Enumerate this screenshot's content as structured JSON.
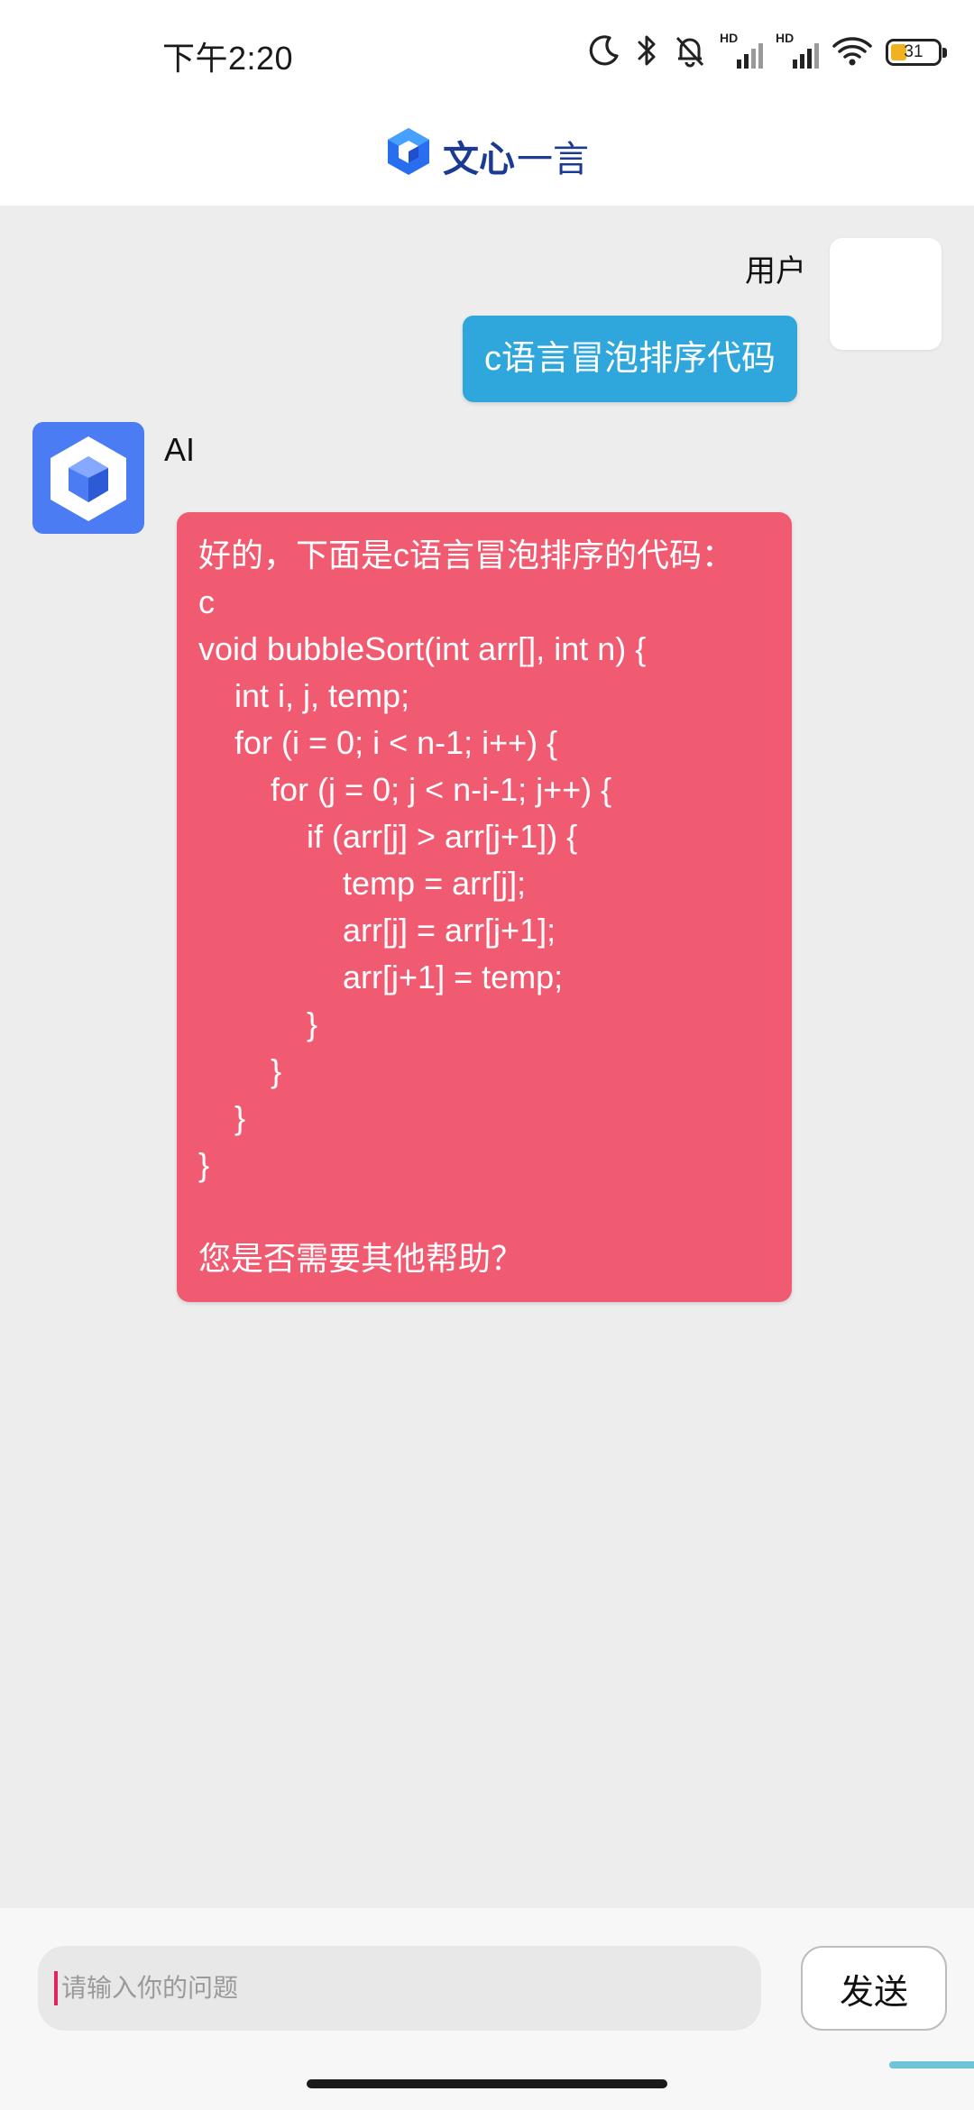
{
  "status_bar": {
    "time": "下午2:20",
    "signal1_label": "HD",
    "signal2_label": "HD",
    "battery": "31",
    "icons": [
      "moon-icon",
      "bluetooth-icon",
      "bell-off-icon",
      "signal-icon",
      "signal-icon",
      "wifi-icon",
      "battery-icon"
    ]
  },
  "header": {
    "brand_part1": "文心",
    "brand_part2": "一言",
    "logo_icon": "wenxin-logo-icon"
  },
  "chat": {
    "user": {
      "name": "用户",
      "message": "c语言冒泡排序代码"
    },
    "ai": {
      "name": "AI",
      "message": "好的，下面是c语言冒泡排序的代码：\nc\nvoid bubbleSort(int arr[], int n) {\n    int i, j, temp;\n    for (i = 0; i < n-1; i++) {\n        for (j = 0; j < n-i-1; j++) {\n            if (arr[j] > arr[j+1]) {\n                temp = arr[j];\n                arr[j] = arr[j+1];\n                arr[j+1] = temp;\n            }\n        }\n    }\n}\n\n您是否需要其他帮助？"
    }
  },
  "input": {
    "placeholder": "请输入你的问题",
    "send_label": "发送"
  },
  "colors": {
    "user_bubble": "#2fa6dc",
    "ai_bubble": "#f05b72",
    "ai_avatar": "#4b7cf3",
    "brand": "#1b3a93"
  }
}
